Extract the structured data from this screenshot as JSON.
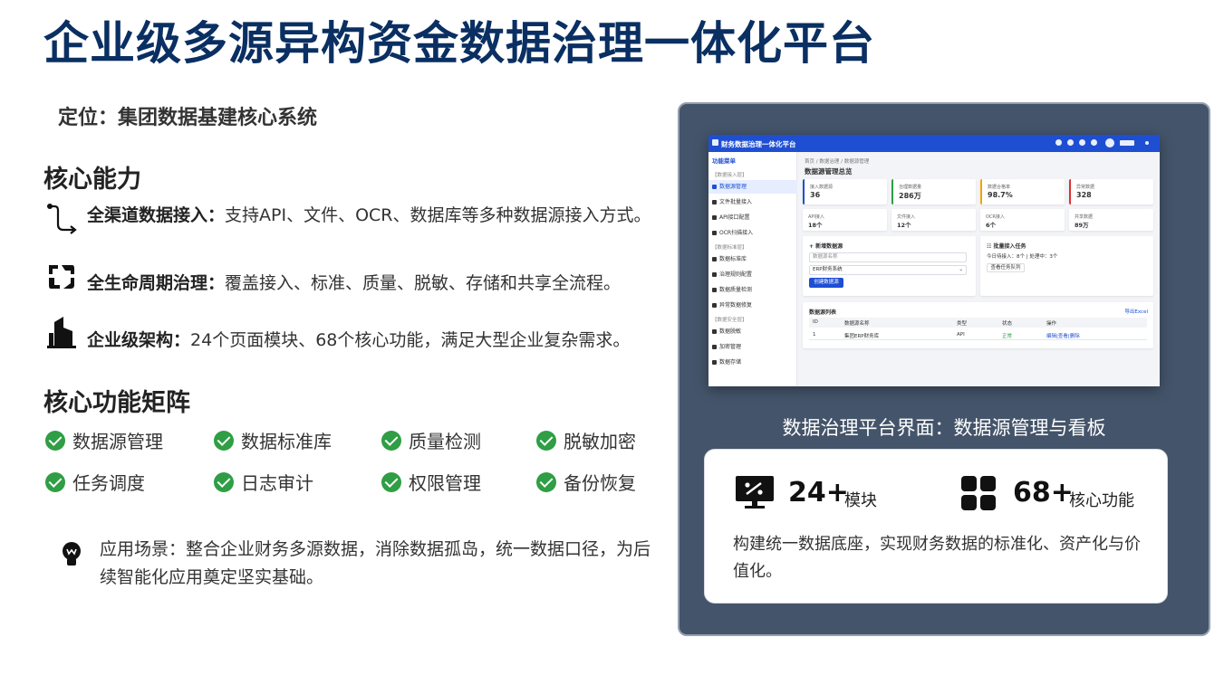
{
  "title": "企业级多源异构资金数据治理一体化平台",
  "positioning": "定位：集团数据基建核心系统",
  "capabilities": {
    "heading": "核心能力",
    "items": [
      {
        "icon": "route-icon",
        "name": "全渠道数据接入：",
        "desc": "支持API、文件、OCR、数据库等多种数据源接入方式。"
      },
      {
        "icon": "lifecycle-icon",
        "name": "全生命周期治理：",
        "desc": "覆盖接入、标准、质量、脱敏、存储和共享全流程。"
      },
      {
        "icon": "building-icon",
        "name": "企业级架构：",
        "desc": "24个页面模块、68个核心功能，满足大型企业复杂需求。"
      }
    ]
  },
  "matrix": {
    "heading": "核心功能矩阵",
    "items": [
      "数据源管理",
      "数据标准库",
      "质量检测",
      "脱敏加密",
      "任务调度",
      "日志审计",
      "权限管理",
      "备份恢复"
    ]
  },
  "scenario": "应用场景：整合企业财务多源数据，消除数据孤岛，统一数据口径，为后续智能化应用奠定坚实基础。",
  "screenshot": {
    "app_title": "财务数据治理一体化平台",
    "menu_title": "功能菜单",
    "groups": [
      "【数据接入层】",
      "【数据标准层】",
      "【数据安全层】"
    ],
    "menu": [
      "数据源管理",
      "文件批量接入",
      "API接口配置",
      "OCR扫描接入",
      "数据标准库",
      "治理规则配置",
      "数据质量检测",
      "异常数据修复",
      "数据脱敏",
      "加密管理",
      "数据存储"
    ],
    "breadcrumb": "首页 / 数据治理 / 数据源管理",
    "page_heading": "数据源管理总览",
    "stats": [
      {
        "label": "接入数据源",
        "value": "36",
        "color": "#1e4fd3"
      },
      {
        "label": "治理数据量",
        "value": "286万",
        "color": "#2f9e44"
      },
      {
        "label": "数据合格率",
        "value": "98.7%",
        "color": "#f0a500"
      },
      {
        "label": "异常数据",
        "value": "328",
        "color": "#e03131"
      }
    ],
    "stats2": [
      {
        "label": "API接入",
        "value": "18个"
      },
      {
        "label": "文件接入",
        "value": "12个"
      },
      {
        "label": "OCR接入",
        "value": "6个"
      },
      {
        "label": "共享数据",
        "value": "89万"
      }
    ],
    "new_source": {
      "heading": "+ 新增数据源",
      "name_placeholder": "数据源名称",
      "select_value": "ERP财务系统",
      "button": "创建数据源"
    },
    "batch": {
      "heading": "☷ 批量接入任务",
      "status": "今日待接入：8个 | 处理中：3个",
      "button": "查看任务队列"
    },
    "table": {
      "heading": "数据源列表",
      "export": "导出Excel",
      "columns": [
        "ID",
        "数据源名称",
        "类型",
        "状态",
        "操作"
      ],
      "rows": [
        [
          "1",
          "集团ERP财务库",
          "API",
          "正常",
          "编辑|查看|删除"
        ]
      ]
    }
  },
  "caption": "数据治理平台界面：数据源管理与看板",
  "metrics": [
    {
      "icon": "monitor-icon",
      "value": "24+",
      "label": "模块"
    },
    {
      "icon": "grid-icon",
      "value": "68+",
      "label": "核心功能"
    }
  ],
  "card_desc": "构建统一数据底座，实现财务数据的标准化、资产化与价值化。",
  "colors": {
    "title": "#0a2f62",
    "check": "#2f9e44",
    "panel": "#44546a",
    "app_bar": "#1e4fd3"
  }
}
